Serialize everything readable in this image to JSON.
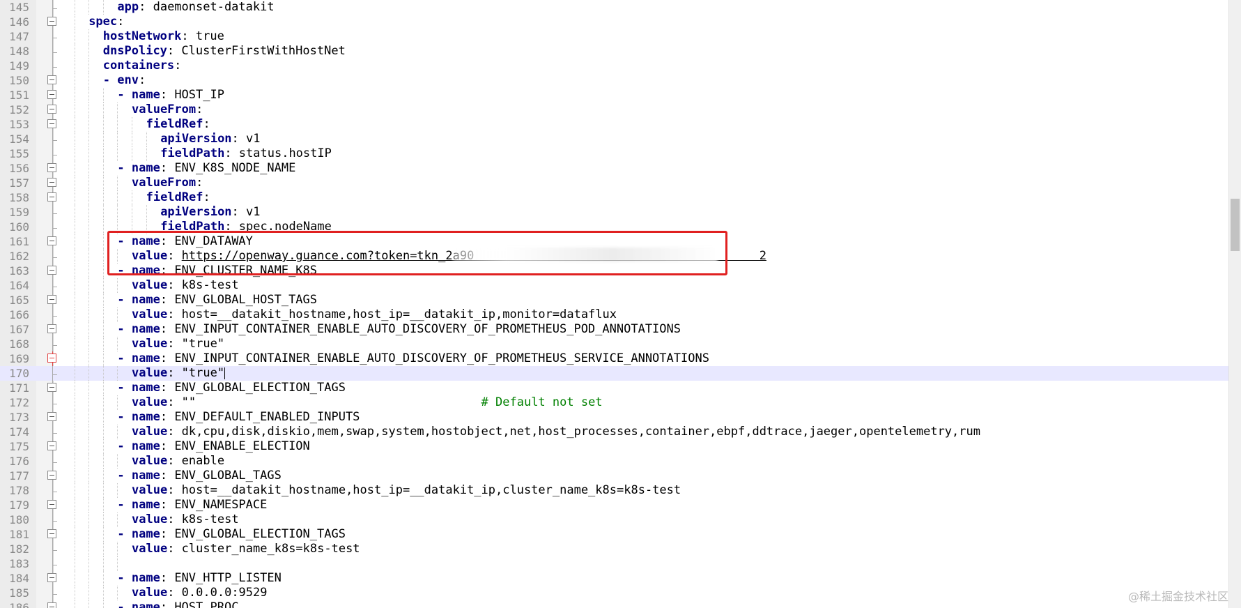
{
  "editor": {
    "lines": [
      {
        "num": "145",
        "indent": 4,
        "key": "app",
        "value": "daemonset-datakit"
      },
      {
        "num": "146",
        "indent": 2,
        "key": "spec",
        "value": ""
      },
      {
        "num": "147",
        "indent": 3,
        "key": "hostNetwork",
        "value": "true"
      },
      {
        "num": "148",
        "indent": 3,
        "key": "dnsPolicy",
        "value": "ClusterFirstWithHostNet"
      },
      {
        "num": "149",
        "indent": 3,
        "key": "containers",
        "value": ""
      },
      {
        "num": "150",
        "indent": 3,
        "key": "env",
        "value": "",
        "dash": true
      },
      {
        "num": "151",
        "indent": 4,
        "key": "name",
        "value": "HOST_IP",
        "dash": true
      },
      {
        "num": "152",
        "indent": 5,
        "key": "valueFrom",
        "value": ""
      },
      {
        "num": "153",
        "indent": 6,
        "key": "fieldRef",
        "value": ""
      },
      {
        "num": "154",
        "indent": 7,
        "key": "apiVersion",
        "value": "v1"
      },
      {
        "num": "155",
        "indent": 7,
        "key": "fieldPath",
        "value": "status.hostIP"
      },
      {
        "num": "156",
        "indent": 4,
        "key": "name",
        "value": "ENV_K8S_NODE_NAME",
        "dash": true
      },
      {
        "num": "157",
        "indent": 5,
        "key": "valueFrom",
        "value": ""
      },
      {
        "num": "158",
        "indent": 6,
        "key": "fieldRef",
        "value": ""
      },
      {
        "num": "159",
        "indent": 7,
        "key": "apiVersion",
        "value": "v1"
      },
      {
        "num": "160",
        "indent": 7,
        "key": "fieldPath",
        "value": "spec.nodeName"
      },
      {
        "num": "161",
        "indent": 4,
        "key": "name",
        "value": "ENV_DATAWAY",
        "dash": true
      },
      {
        "num": "162",
        "indent": 5,
        "key": "value",
        "value": "https://openway.guance.com?token=tkn_2a90                                        2",
        "url": true
      },
      {
        "num": "163",
        "indent": 4,
        "key": "name",
        "value": "ENV_CLUSTER_NAME_K8S",
        "dash": true
      },
      {
        "num": "164",
        "indent": 5,
        "key": "value",
        "value": "k8s-test"
      },
      {
        "num": "165",
        "indent": 4,
        "key": "name",
        "value": "ENV_GLOBAL_HOST_TAGS",
        "dash": true
      },
      {
        "num": "166",
        "indent": 5,
        "key": "value",
        "value": "host=__datakit_hostname,host_ip=__datakit_ip,monitor=dataflux"
      },
      {
        "num": "167",
        "indent": 4,
        "key": "name",
        "value": "ENV_INPUT_CONTAINER_ENABLE_AUTO_DISCOVERY_OF_PROMETHEUS_POD_ANNOTATIONS",
        "dash": true
      },
      {
        "num": "168",
        "indent": 5,
        "key": "value",
        "value": "\"true\""
      },
      {
        "num": "169",
        "indent": 4,
        "key": "name",
        "value": "ENV_INPUT_CONTAINER_ENABLE_AUTO_DISCOVERY_OF_PROMETHEUS_SERVICE_ANNOTATIONS",
        "dash": true
      },
      {
        "num": "170",
        "indent": 5,
        "key": "value",
        "value": "\"true\"",
        "current": true
      },
      {
        "num": "171",
        "indent": 4,
        "key": "name",
        "value": "ENV_GLOBAL_ELECTION_TAGS",
        "dash": true
      },
      {
        "num": "172",
        "indent": 5,
        "key": "value",
        "value": "\"\"                                        ",
        "comment": "# Default not set"
      },
      {
        "num": "173",
        "indent": 4,
        "key": "name",
        "value": "ENV_DEFAULT_ENABLED_INPUTS",
        "dash": true
      },
      {
        "num": "174",
        "indent": 5,
        "key": "value",
        "value": "dk,cpu,disk,diskio,mem,swap,system,hostobject,net,host_processes,container,ebpf,ddtrace,jaeger,opentelemetry,rum"
      },
      {
        "num": "175",
        "indent": 4,
        "key": "name",
        "value": "ENV_ENABLE_ELECTION",
        "dash": true
      },
      {
        "num": "176",
        "indent": 5,
        "key": "value",
        "value": "enable"
      },
      {
        "num": "177",
        "indent": 4,
        "key": "name",
        "value": "ENV_GLOBAL_TAGS",
        "dash": true
      },
      {
        "num": "178",
        "indent": 5,
        "key": "value",
        "value": "host=__datakit_hostname,host_ip=__datakit_ip,cluster_name_k8s=k8s-test"
      },
      {
        "num": "179",
        "indent": 4,
        "key": "name",
        "value": "ENV_NAMESPACE",
        "dash": true
      },
      {
        "num": "180",
        "indent": 5,
        "key": "value",
        "value": "k8s-test"
      },
      {
        "num": "181",
        "indent": 4,
        "key": "name",
        "value": "ENV_GLOBAL_ELECTION_TAGS",
        "dash": true
      },
      {
        "num": "182",
        "indent": 5,
        "key": "value",
        "value": "cluster_name_k8s=k8s-test"
      },
      {
        "num": "183",
        "indent": 5,
        "key": "",
        "value": ""
      },
      {
        "num": "184",
        "indent": 4,
        "key": "name",
        "value": "ENV_HTTP_LISTEN",
        "dash": true
      },
      {
        "num": "185",
        "indent": 5,
        "key": "value",
        "value": "0.0.0.0:9529"
      },
      {
        "num": "186",
        "indent": 4,
        "key": "name",
        "value": "HOST_PROC",
        "dash": true
      }
    ]
  },
  "watermark": "@稀土掘金技术社区",
  "colors": {
    "key": "#000080",
    "comment": "#008000",
    "highlight_box": "#e02020",
    "current_line": "#e8e8ff"
  }
}
